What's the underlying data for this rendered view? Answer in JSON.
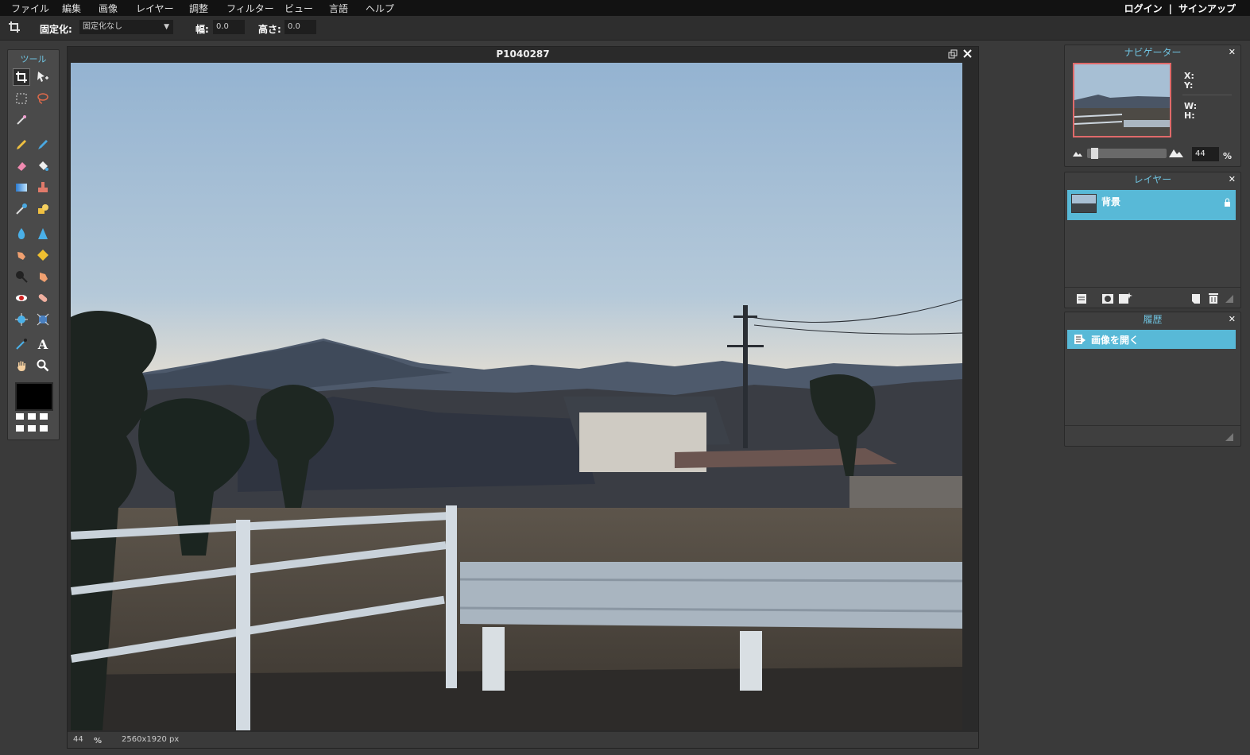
{
  "menu": {
    "items": [
      "ファイル",
      "編集",
      "画像",
      "レイヤー",
      "調整",
      "フィルター",
      "ビュー",
      "言語",
      "ヘルプ"
    ],
    "login": "ログイン",
    "separator": "|",
    "signup": "サインアップ"
  },
  "options": {
    "fix_label": "固定化:",
    "fix_value": "固定化なし",
    "width_label": "幅:",
    "width_value": "0.0",
    "height_label": "高さ:",
    "height_value": "0.0"
  },
  "toolbox": {
    "title": "ツール",
    "text_tool_glyph": "A",
    "foreground_color": "#000000"
  },
  "document": {
    "title": "P1040287",
    "zoom": "44",
    "zoom_unit": "%",
    "dimensions": "2560x1920 px"
  },
  "navigator": {
    "title": "ナビゲーター",
    "x_label": "X:",
    "y_label": "Y:",
    "w_label": "W:",
    "h_label": "H:",
    "zoom_value": "44",
    "zoom_unit": "%",
    "zoom_level": 0.05
  },
  "layers": {
    "title": "レイヤー",
    "items": [
      {
        "name": "背景",
        "locked": true
      }
    ]
  },
  "history": {
    "title": "履歴",
    "items": [
      "画像を開く"
    ]
  },
  "colors": {
    "accent": "#58b9d7",
    "panel_title": "#6fc3e0"
  }
}
